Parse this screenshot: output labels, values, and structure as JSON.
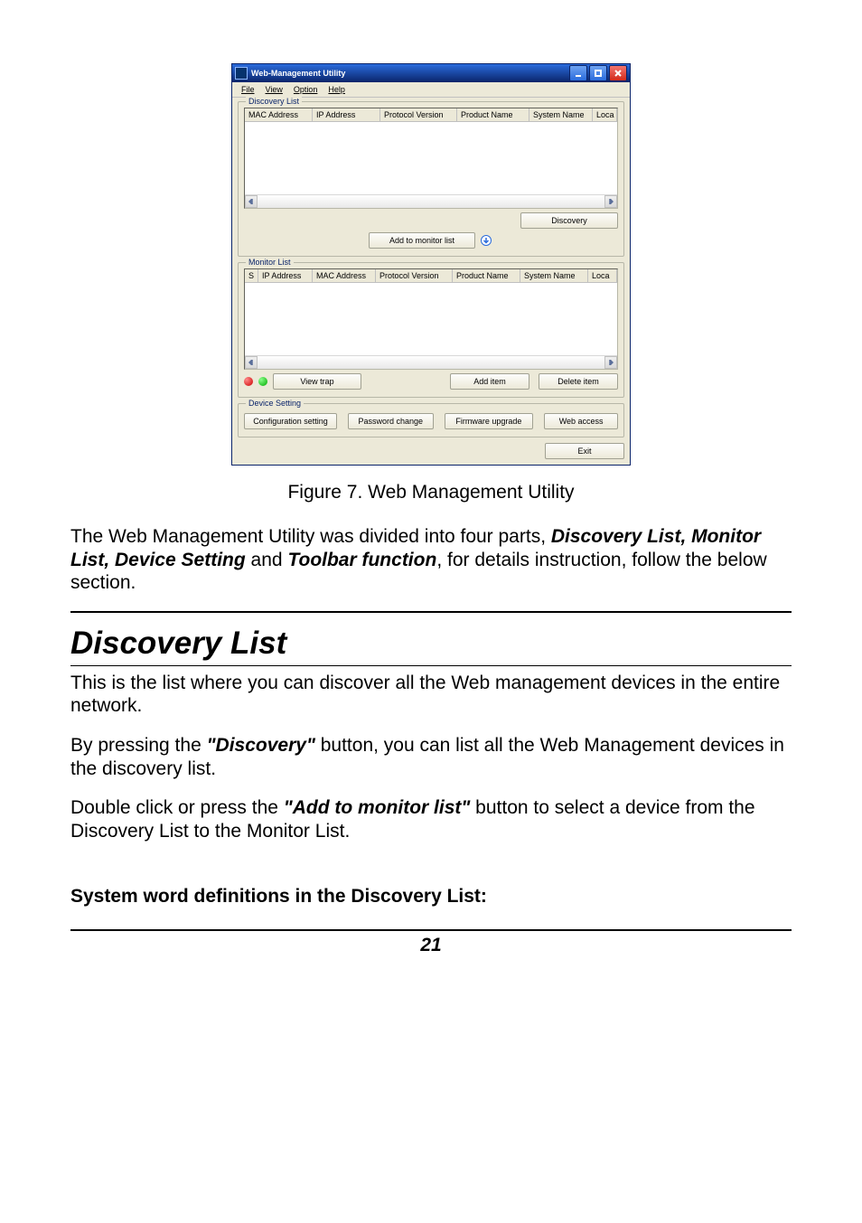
{
  "app_window": {
    "title": "Web-Management Utility",
    "menubar": [
      "File",
      "View",
      "Option",
      "Help"
    ],
    "discovery": {
      "legend": "Discovery List",
      "columns": [
        "MAC Address",
        "IP Address",
        "Protocol Version",
        "Product Name",
        "System Name",
        "Loca"
      ],
      "discovery_button": "Discovery",
      "add_to_monitor_button": "Add to monitor list"
    },
    "monitor": {
      "legend": "Monitor List",
      "columns": [
        "S",
        "IP Address",
        "MAC Address",
        "Protocol Version",
        "Product Name",
        "System Name",
        "Loca"
      ],
      "view_trap_button": "View trap",
      "add_item_button": "Add item",
      "delete_item_button": "Delete item"
    },
    "device_setting": {
      "legend": "Device Setting",
      "configuration_setting_button": "Configuration setting",
      "password_change_button": "Password change",
      "firmware_upgrade_button": "Firmware upgrade",
      "web_access_button": "Web access"
    },
    "exit_button": "Exit"
  },
  "caption": "Figure 7. Web Management Utility",
  "para1_a": "The Web Management Utility was divided into four parts, ",
  "para1_b": "Discovery List, Monitor List, Device Setting",
  "para1_c": " and ",
  "para1_d": "Toolbar function",
  "para1_e": ", for details instruction, follow the below section.",
  "section_heading": "Discovery List",
  "para2": "This is the list where you can discover all the Web management devices in the entire network.",
  "para3_a": "By pressing the ",
  "para3_b": "\"Discovery\"",
  "para3_c": " button, you can list all the Web Management devices in the discovery list.",
  "para4_a": "Double click or press the ",
  "para4_b": "\"Add to monitor list\"",
  "para4_c": " button to select a device from the Discovery List to the Monitor List.",
  "subheading": "System word definitions in the Discovery List:",
  "page_number": "21"
}
